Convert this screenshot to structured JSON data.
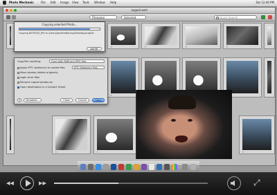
{
  "menubar": {
    "app_name": "Photo Mechanic",
    "items": [
      "File",
      "Edit",
      "Image",
      "View",
      "Tools",
      "Window",
      "Help"
    ],
    "clock": "Sat 12:40 PM"
  },
  "window": {
    "title": "august.wed",
    "toolbar": {
      "sort_label": "Filename",
      "filter_label": "Selected",
      "search_placeholder": "Quick Search"
    }
  },
  "copy_dialog": {
    "title": "Copying selected Photo...",
    "path": "Copying 8078303_JPG to /Users/jsadlersBackup/Desktop/augS3c",
    "progress": 0.88,
    "stop_label": "ABORT"
  },
  "options_sheet": {
    "heading": "Copy/File handling:",
    "handling_value": "Copy both RAW and JPEG files",
    "options": [
      {
        "label": "Apply IPTC stationery to copied files",
        "checked": false
      },
      {
        "label": "Move photos (delete originals)",
        "checked": false
      },
      {
        "label": "Login error files",
        "checked": false
      },
      {
        "label": "Rename copied photos as:",
        "checked": false
      },
      {
        "label": "Open destination in a Contact Sheet",
        "checked": true
      }
    ],
    "iptc_button": "IPTC Stationery Pad...",
    "variables_button": "Variables...",
    "close_button": "Close",
    "cancel_button": "Cancel",
    "copy_button": "Copy",
    "help_label": "?"
  },
  "colors": {
    "accent": "#3b7bd8",
    "window_bg": "#c9c9c9",
    "player_bg": "#111111"
  },
  "player": {
    "progress": 0.42
  }
}
